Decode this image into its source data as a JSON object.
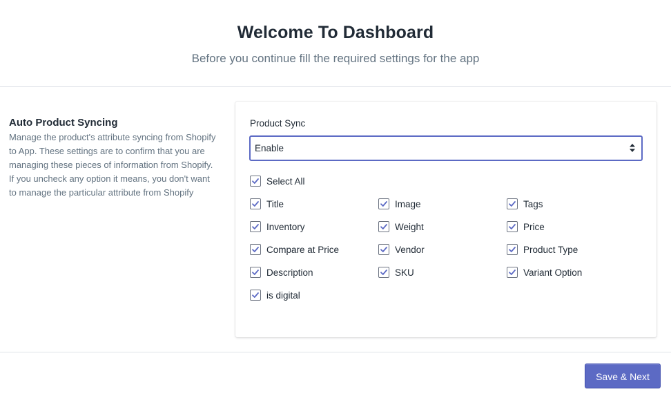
{
  "header": {
    "title": "Welcome To Dashboard",
    "subtitle": "Before you continue fill the required settings for the app"
  },
  "section": {
    "title": "Auto Product Syncing",
    "description": "Manage the product's attribute syncing from Shopify to App. These settings are to confirm that you are managing these pieces of information from Shopify. If you uncheck any option it means, you don't want to manage the particular attribute from Shopify"
  },
  "product_sync": {
    "label": "Product Sync",
    "selected": "Enable"
  },
  "checkboxes": {
    "select_all": {
      "label": "Select All",
      "checked": true
    },
    "title": {
      "label": "Title",
      "checked": true
    },
    "image": {
      "label": "Image",
      "checked": true
    },
    "tags": {
      "label": "Tags",
      "checked": true
    },
    "inventory": {
      "label": "Inventory",
      "checked": true
    },
    "weight": {
      "label": "Weight",
      "checked": true
    },
    "price": {
      "label": "Price",
      "checked": true
    },
    "compare_at_price": {
      "label": "Compare at Price",
      "checked": true
    },
    "vendor": {
      "label": "Vendor",
      "checked": true
    },
    "product_type": {
      "label": "Product Type",
      "checked": true
    },
    "description": {
      "label": "Description",
      "checked": true
    },
    "sku": {
      "label": "SKU",
      "checked": true
    },
    "variant_option": {
      "label": "Variant Option",
      "checked": true
    },
    "is_digital": {
      "label": "is digital",
      "checked": true
    }
  },
  "footer": {
    "save_next_label": "Save & Next"
  },
  "colors": {
    "accent": "#5c6ac4",
    "checkbox_check": "#5c6ac4",
    "muted_text": "#637381"
  }
}
